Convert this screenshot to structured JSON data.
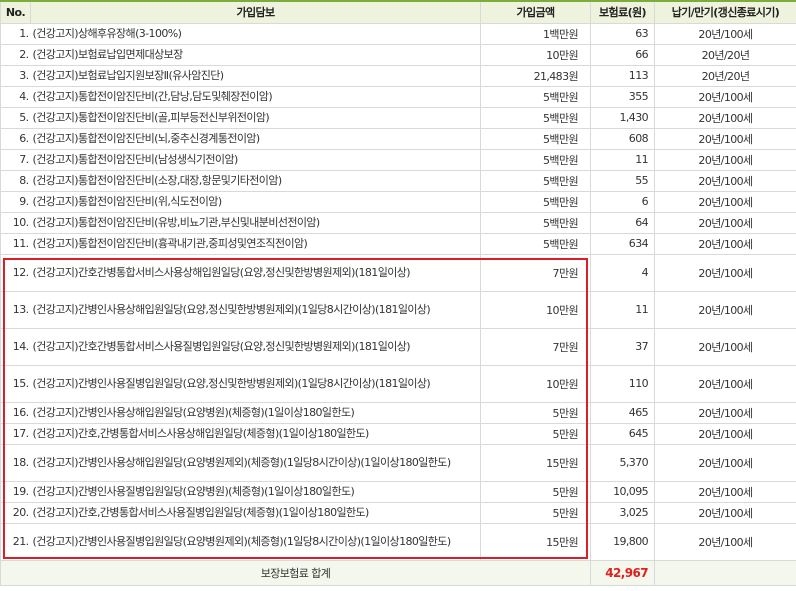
{
  "headers": {
    "no": "No.",
    "coverage": "가입담보",
    "amount": "가입금액",
    "premium": "보험료(원)",
    "term": "납기/만기(갱신종료시기)"
  },
  "rows": [
    {
      "no": "1.",
      "name": "(건강고지)상해후유장해(3-100%)",
      "amount": "1백만원",
      "premium": "63",
      "term": "20년/100세"
    },
    {
      "no": "2.",
      "name": "(건강고지)보험료납입면제대상보장",
      "amount": "10만원",
      "premium": "66",
      "term": "20년/20년"
    },
    {
      "no": "3.",
      "name": "(건강고지)보험료납입지원보장Ⅱ(유사암진단)",
      "amount": "21,483원",
      "premium": "113",
      "term": "20년/20년"
    },
    {
      "no": "4.",
      "name": "(건강고지)통합전이암진단비(간,담낭,담도및췌장전이암)",
      "amount": "5백만원",
      "premium": "355",
      "term": "20년/100세"
    },
    {
      "no": "5.",
      "name": "(건강고지)통합전이암진단비(골,피부등전신부위전이암)",
      "amount": "5백만원",
      "premium": "1,430",
      "term": "20년/100세"
    },
    {
      "no": "6.",
      "name": "(건강고지)통합전이암진단비(뇌,중추신경계통전이암)",
      "amount": "5백만원",
      "premium": "608",
      "term": "20년/100세"
    },
    {
      "no": "7.",
      "name": "(건강고지)통합전이암진단비(남성생식기전이암)",
      "amount": "5백만원",
      "premium": "11",
      "term": "20년/100세"
    },
    {
      "no": "8.",
      "name": "(건강고지)통합전이암진단비(소장,대장,항문및기타전이암)",
      "amount": "5백만원",
      "premium": "55",
      "term": "20년/100세"
    },
    {
      "no": "9.",
      "name": "(건강고지)통합전이암진단비(위,식도전이암)",
      "amount": "5백만원",
      "premium": "6",
      "term": "20년/100세"
    },
    {
      "no": "10.",
      "name": "(건강고지)통합전이암진단비(유방,비뇨기관,부신및내분비선전이암)",
      "amount": "5백만원",
      "premium": "64",
      "term": "20년/100세"
    },
    {
      "no": "11.",
      "name": "(건강고지)통합전이암진단비(흉곽내기관,중피성및연조직전이암)",
      "amount": "5백만원",
      "premium": "634",
      "term": "20년/100세"
    },
    {
      "no": "12.",
      "name": "(건강고지)간호간병통합서비스사용상해입원일당(요양,정신및한방병원제외)(181일이상)",
      "amount": "7만원",
      "premium": "4",
      "term": "20년/100세"
    },
    {
      "no": "13.",
      "name": "(건강고지)간병인사용상해입원일당(요양,정신및한방병원제외)(1일당8시간이상)(181일이상)",
      "amount": "10만원",
      "premium": "11",
      "term": "20년/100세"
    },
    {
      "no": "14.",
      "name": "(건강고지)간호간병통합서비스사용질병입원일당(요양,정신및한방병원제외)(181일이상)",
      "amount": "7만원",
      "premium": "37",
      "term": "20년/100세"
    },
    {
      "no": "15.",
      "name": "(건강고지)간병인사용질병입원일당(요양,정신및한방병원제외)(1일당8시간이상)(181일이상)",
      "amount": "10만원",
      "premium": "110",
      "term": "20년/100세"
    },
    {
      "no": "16.",
      "name": "(건강고지)간병인사용상해입원일당(요양병원)(체증형)(1일이상180일한도)",
      "amount": "5만원",
      "premium": "465",
      "term": "20년/100세"
    },
    {
      "no": "17.",
      "name": "(건강고지)간호,간병통합서비스사용상해입원일당(체증형)(1일이상180일한도)",
      "amount": "5만원",
      "premium": "645",
      "term": "20년/100세"
    },
    {
      "no": "18.",
      "name": "(건강고지)간병인사용상해입원일당(요양병원제외)(체증형)(1일당8시간이상)(1일이상180일한도)",
      "amount": "15만원",
      "premium": "5,370",
      "term": "20년/100세"
    },
    {
      "no": "19.",
      "name": "(건강고지)간병인사용질병입원일당(요양병원)(체증형)(1일이상180일한도)",
      "amount": "5만원",
      "premium": "10,095",
      "term": "20년/100세"
    },
    {
      "no": "20.",
      "name": "(건강고지)간호,간병통합서비스사용질병입원일당(체증형)(1일이상180일한도)",
      "amount": "5만원",
      "premium": "3,025",
      "term": "20년/100세"
    },
    {
      "no": "21.",
      "name": "(건강고지)간병인사용질병입원일당(요양병원제외)(체증형)(1일당8시간이상)(1일이상180일한도)",
      "amount": "15만원",
      "premium": "19,800",
      "term": "20년/100세"
    }
  ],
  "total": {
    "label": "보장보험료 합계",
    "value": "42,967"
  },
  "colors": {
    "highlight_border": "#d81f2a",
    "total_value": "#e02020",
    "header_bg": "#eef3dd"
  }
}
